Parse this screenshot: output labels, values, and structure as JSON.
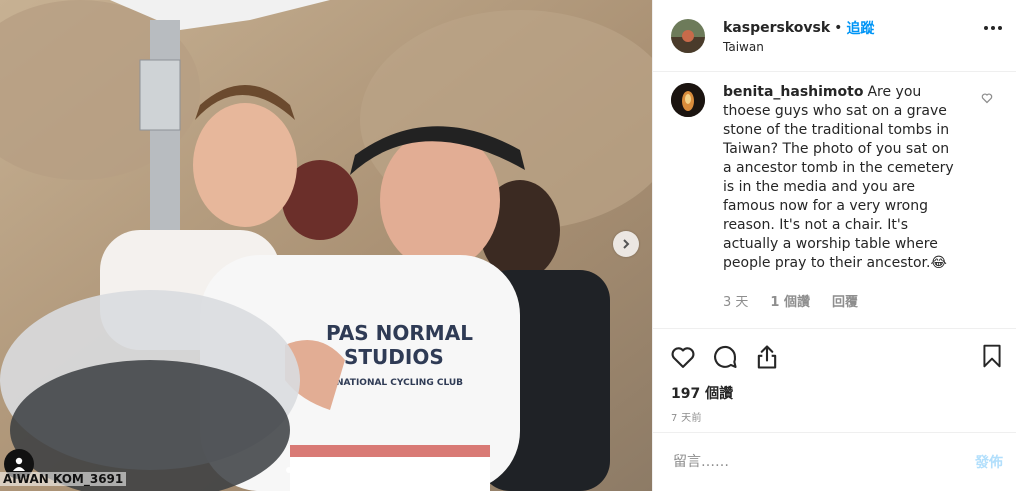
{
  "header": {
    "username": "kasperskovsk",
    "separator": "•",
    "follow_label": "追蹤",
    "location": "Taiwan"
  },
  "photo": {
    "watermark": "AIWAN KOM_3691",
    "jersey_line1": "PAS NORMAL",
    "jersey_line2": "STUDIOS",
    "jersey_line3": "NATIONAL CYCLING CLUB",
    "carousel_dots": 2,
    "active_dot": 0
  },
  "comment": {
    "username": "benita_hashimoto",
    "text": "Are you thoese guys who sat on a grave stone of the traditional tombs in Taiwan? The photo of you sat on a ancestor tomb in the cemetery is in the media and you are famous now for a very wrong reason. It's not a chair. It's actually a worship table where people pray to their ancestor.",
    "emoji": "😂",
    "age": "3 天",
    "likes": "1 個讚",
    "reply_label": "回覆"
  },
  "actions": {
    "likes_count": "197 個讚",
    "posted_ago": "7 天前"
  },
  "add_comment": {
    "placeholder": "留言……",
    "post_label": "發佈"
  },
  "colors": {
    "accent": "#0095f6",
    "post_disabled": "#b2dffc",
    "muted": "#8e8e8e",
    "text": "#262626"
  }
}
